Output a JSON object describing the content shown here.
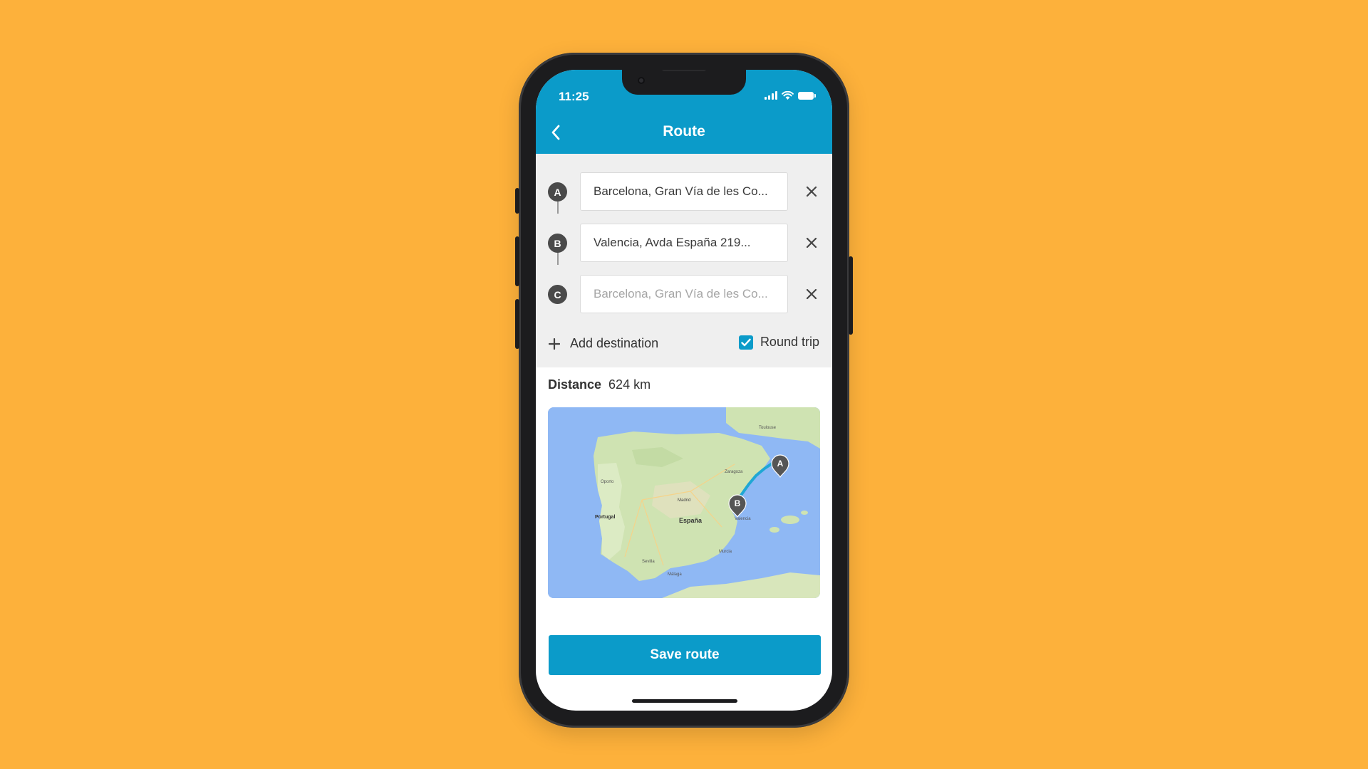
{
  "status_bar": {
    "time": "11:25"
  },
  "header": {
    "title": "Route"
  },
  "stops": [
    {
      "letter": "A",
      "value": "Barcelona, Gran Vía de les Co...",
      "placeholder": ""
    },
    {
      "letter": "B",
      "value": "Valencia, Avda España 219...",
      "placeholder": ""
    },
    {
      "letter": "C",
      "value": "",
      "placeholder": "Barcelona, Gran Vía de les Co..."
    }
  ],
  "actions": {
    "add_destination": "Add destination",
    "round_trip_label": "Round trip",
    "round_trip_checked": true
  },
  "distance": {
    "label": "Distance",
    "value": "624 km"
  },
  "map": {
    "labels": {
      "portugal": "Portugal",
      "espana": "España",
      "madrid": "Madrid",
      "zaragoza": "Zaragoza",
      "toulouse": "Toulouse",
      "valencia": "Valencia",
      "sevilla": "Sevilla",
      "malaga": "Málaga",
      "porto": "Oporto",
      "murcia": "Murcia"
    },
    "markers": [
      {
        "letter": "A"
      },
      {
        "letter": "B"
      }
    ]
  },
  "footer": {
    "save_label": "Save route"
  },
  "colors": {
    "background": "#FDB13B",
    "accent": "#0B9BC9",
    "badge": "#4A4A4A",
    "sea": "#8FB8F4",
    "land": "#CFE3B2"
  },
  "icons": [
    "back-chevron-icon",
    "close-icon",
    "plus-icon",
    "check-icon",
    "signal-icon",
    "wifi-icon",
    "battery-icon",
    "map-pin-icon"
  ]
}
